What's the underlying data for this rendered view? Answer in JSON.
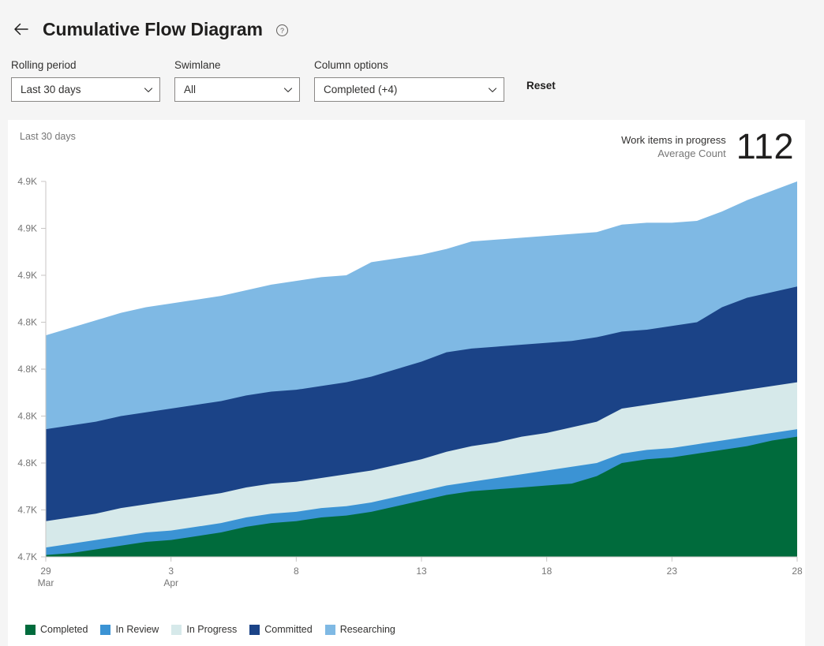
{
  "header": {
    "back_icon": "back-arrow-icon",
    "title": "Cumulative Flow Diagram",
    "help_icon": "help-circle-icon"
  },
  "filters": {
    "rolling_period": {
      "label": "Rolling period",
      "value": "Last 30 days",
      "chevron_icon": "chevron-down-icon"
    },
    "swimlane": {
      "label": "Swimlane",
      "value": "All",
      "chevron_icon": "chevron-down-icon"
    },
    "column_options": {
      "label": "Column options",
      "value": "Completed (+4)",
      "chevron_icon": "chevron-down-icon"
    },
    "reset_label": "Reset"
  },
  "card": {
    "range_caption": "Last 30 days",
    "kpi_title": "Work items in progress",
    "kpi_subtitle": "Average Count",
    "kpi_value": "112"
  },
  "colors": {
    "completed": "#006b3c",
    "in_review": "#3b93d4",
    "in_progress": "#d6e9ea",
    "committed": "#1b4387",
    "researching": "#7fb9e4",
    "axis": "#c8c6c4",
    "text_muted": "#767676",
    "card_bg": "#ffffff",
    "page_bg": "#f5f5f5"
  },
  "chart_data": {
    "type": "area",
    "stacked": true,
    "title": "Cumulative Flow Diagram",
    "xlabel": "",
    "ylabel": "",
    "grid": false,
    "legend_position": "bottom-left",
    "x_tick_labels": [
      "29",
      "3",
      "8",
      "13",
      "18",
      "23",
      "28"
    ],
    "x_tick_sublabels": [
      "Mar",
      "Apr",
      "",
      "",
      "",
      "",
      ""
    ],
    "x_tick_values": [
      0,
      5,
      10,
      15,
      20,
      25,
      30
    ],
    "y_tick_labels": [
      "4.7K",
      "4.7K",
      "4.8K",
      "4.8K",
      "4.8K",
      "4.8K",
      "4.9K",
      "4.9K",
      "4.9K"
    ],
    "y_tick_values": [
      4700,
      4725,
      4750,
      4775,
      4800,
      4825,
      4850,
      4875,
      4900
    ],
    "ylim": [
      4700,
      4900
    ],
    "xlim": [
      0,
      30
    ],
    "x": [
      0,
      1,
      2,
      3,
      4,
      5,
      6,
      7,
      8,
      9,
      10,
      11,
      12,
      13,
      14,
      15,
      16,
      17,
      18,
      19,
      20,
      21,
      22,
      23,
      24,
      25,
      26,
      27,
      28,
      29,
      30
    ],
    "series": [
      {
        "name": "Completed",
        "color": "#006b3c",
        "values": [
          4701,
          4702,
          4704,
          4706,
          4708,
          4709,
          4711,
          4713,
          4716,
          4718,
          4719,
          4721,
          4722,
          4724,
          4727,
          4730,
          4733,
          4735,
          4736,
          4737,
          4738,
          4739,
          4743,
          4750,
          4752,
          4753,
          4755,
          4757,
          4759,
          4762,
          4764
        ]
      },
      {
        "name": "In Review",
        "color": "#3b93d4",
        "values": [
          4705,
          4707,
          4709,
          4711,
          4713,
          4714,
          4716,
          4718,
          4721,
          4723,
          4724,
          4726,
          4727,
          4729,
          4732,
          4735,
          4738,
          4740,
          4742,
          4744,
          4746,
          4748,
          4750,
          4755,
          4757,
          4758,
          4760,
          4762,
          4764,
          4766,
          4768
        ]
      },
      {
        "name": "In Progress",
        "color": "#d6e9ea",
        "values": [
          4719,
          4721,
          4723,
          4726,
          4728,
          4730,
          4732,
          4734,
          4737,
          4739,
          4740,
          4742,
          4744,
          4746,
          4749,
          4752,
          4756,
          4759,
          4761,
          4764,
          4766,
          4769,
          4772,
          4779,
          4781,
          4783,
          4785,
          4787,
          4789,
          4791,
          4793
        ]
      },
      {
        "name": "Committed",
        "color": "#1b4387",
        "values": [
          4768,
          4770,
          4772,
          4775,
          4777,
          4779,
          4781,
          4783,
          4786,
          4788,
          4789,
          4791,
          4793,
          4796,
          4800,
          4804,
          4809,
          4811,
          4812,
          4813,
          4814,
          4815,
          4817,
          4820,
          4821,
          4823,
          4825,
          4833,
          4838,
          4841,
          4844
        ]
      },
      {
        "name": "Researching",
        "color": "#7fb9e4",
        "values": [
          4818,
          4822,
          4826,
          4830,
          4833,
          4835,
          4837,
          4839,
          4842,
          4845,
          4847,
          4849,
          4850,
          4857,
          4859,
          4861,
          4864,
          4868,
          4869,
          4870,
          4871,
          4872,
          4873,
          4877,
          4878,
          4878,
          4879,
          4884,
          4890,
          4895,
          4900
        ]
      }
    ]
  }
}
